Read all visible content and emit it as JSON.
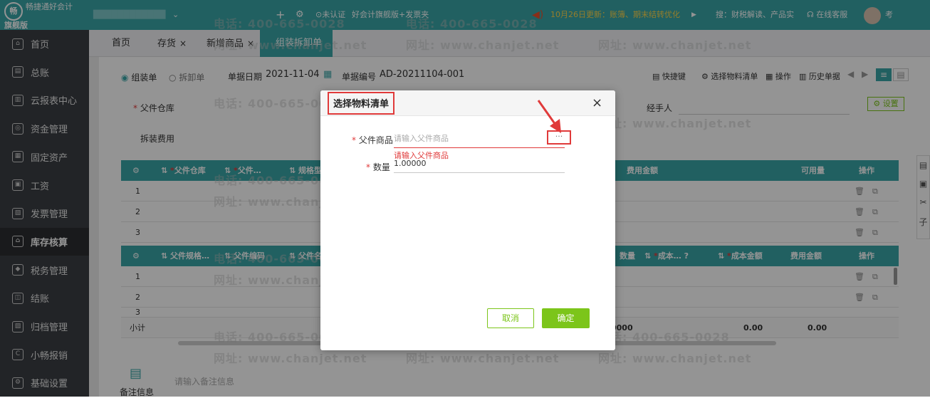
{
  "app": {
    "logo_line1": "畅捷通好会计",
    "logo_line2": "旗舰版",
    "logo_mark": "畅"
  },
  "topbar": {
    "account": "████████████",
    "cert": "未认证",
    "edition": "好会计旗舰版+发票夹",
    "notice": "10月26日更新：账簿、期末结转优化",
    "search_hint": "搜：财税解读、产品实",
    "service": "在线客服",
    "user": "考"
  },
  "sidebar": {
    "items": [
      {
        "label": "首页",
        "icon": "home-icon"
      },
      {
        "label": "总账",
        "icon": "ledger-icon"
      },
      {
        "label": "云报表中心",
        "icon": "chart-icon"
      },
      {
        "label": "资金管理",
        "icon": "money-icon"
      },
      {
        "label": "固定资产",
        "icon": "asset-icon"
      },
      {
        "label": "工资",
        "icon": "salary-icon"
      },
      {
        "label": "发票管理",
        "icon": "invoice-icon"
      },
      {
        "label": "库存核算",
        "icon": "warehouse-icon"
      },
      {
        "label": "税务管理",
        "icon": "tax-icon"
      },
      {
        "label": "结账",
        "icon": "close-books-icon"
      },
      {
        "label": "归档管理",
        "icon": "archive-icon"
      },
      {
        "label": "小畅报销",
        "icon": "reimburse-icon"
      },
      {
        "label": "基础设置",
        "icon": "settings-icon"
      }
    ]
  },
  "tabs": [
    {
      "label": "首页"
    },
    {
      "label": "存货"
    },
    {
      "label": "新增商品"
    },
    {
      "label": "组装拆卸单"
    }
  ],
  "form": {
    "type_assemble": "组装单",
    "type_disassemble": "拆卸单",
    "date_label": "单据日期",
    "date_value": "2021-11-04",
    "number_label": "单据编号",
    "number_value": "AD-20211104-001",
    "parent_warehouse": "父件仓库",
    "assemble_fee": "拆装费用",
    "handler": "经手人",
    "toolbar": [
      "快捷键",
      "选择物料清单",
      "操作",
      "历史单据"
    ],
    "settings": "设置",
    "remark_label": "备注信息",
    "remark_placeholder": "请输入备注信息"
  },
  "grid1": {
    "headers": [
      "父件仓库",
      "父件…",
      "规格型",
      "费用金额",
      "可用量",
      "操作"
    ],
    "rows": [
      "1",
      "2",
      "3"
    ]
  },
  "grid2": {
    "headers": [
      "父件规格…",
      "父件编码",
      "父件名",
      "数量",
      "成本…",
      "成本金额",
      "费用金额",
      "操作"
    ],
    "rows": [
      "1",
      "2",
      "3"
    ],
    "subtotal_label": "小计",
    "subtotal_qty": "0000",
    "subtotal_cost": "0.00",
    "subtotal_fee": "0.00"
  },
  "watermarks": {
    "phone": "电话: 400-665-0028",
    "site": "网址: www.chanjet.net"
  },
  "dialog": {
    "title": "选择物料清单",
    "parent_label": "父件商品",
    "parent_placeholder": "请输入父件商品",
    "parent_error": "请输入父件商品",
    "more_button": "···",
    "qty_label": "数量",
    "qty_value": "1.00000",
    "cancel": "取消",
    "confirm": "确定",
    "close": "×"
  },
  "colors": {
    "brand": "#3aa6a8",
    "error": "#e03a3a",
    "confirm": "#7cc51a"
  }
}
